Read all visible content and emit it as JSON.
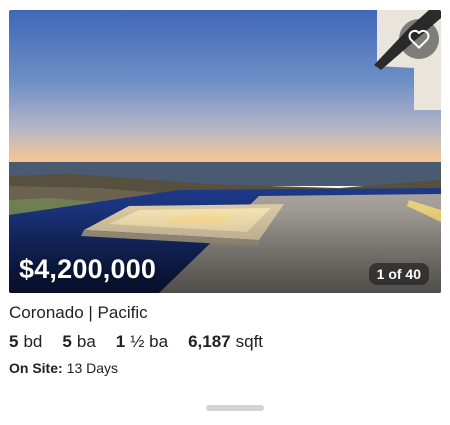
{
  "listing": {
    "price": "$4,200,000",
    "photo_counter": "1 of 40",
    "address": "Coronado | Pacific",
    "facts": [
      {
        "value": "5",
        "unit": "bd"
      },
      {
        "value": "5",
        "unit": "ba"
      },
      {
        "value": "1",
        "unit": "½ ba"
      },
      {
        "value": "6,187",
        "unit": "sqft"
      }
    ],
    "on_site_label": "On Site:",
    "on_site_value": "13 Days"
  },
  "icons": {
    "favorite": "heart-icon"
  },
  "colors": {
    "price_text": "#ffffff",
    "counter_bg": "#232323",
    "handle": "#d3d3d3"
  }
}
